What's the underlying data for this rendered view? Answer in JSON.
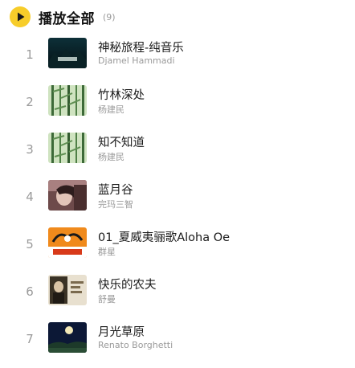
{
  "header": {
    "play_icon": "play-icon",
    "title": "播放全部",
    "count": "(9)"
  },
  "colors": {
    "accent": "#f7cd2a",
    "title_text": "#1a1a1a",
    "secondary_text": "#9a9a9a"
  },
  "songs": [
    {
      "index": "1",
      "title": "神秘旅程-纯音乐",
      "artist": "Djamel Hammadi",
      "cover": "album-cover-dark-forest"
    },
    {
      "index": "2",
      "title": "竹林深处",
      "artist": "杨建民",
      "cover": "album-cover-bamboo"
    },
    {
      "index": "3",
      "title": "知不知道",
      "artist": "杨建民",
      "cover": "album-cover-bamboo"
    },
    {
      "index": "4",
      "title": "蓝月谷",
      "artist": "完玛三智",
      "cover": "album-cover-portrait"
    },
    {
      "index": "5",
      "title": "01_夏威夷骊歌Aloha Oe",
      "artist": "群星",
      "cover": "album-cover-aloha"
    },
    {
      "index": "6",
      "title": "快乐的农夫",
      "artist": "舒曼",
      "cover": "album-cover-schumann"
    },
    {
      "index": "7",
      "title": "月光草原",
      "artist": "Renato Borghetti",
      "cover": "album-cover-moonlight"
    }
  ]
}
